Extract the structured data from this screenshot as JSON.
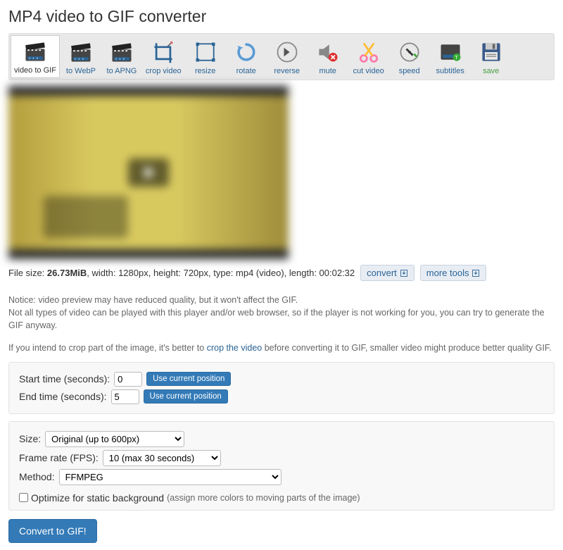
{
  "title": "MP4 video to GIF converter",
  "toolbar": [
    {
      "label": "video to GIF",
      "icon": "clapper"
    },
    {
      "label": "to WebP",
      "icon": "clapper"
    },
    {
      "label": "to APNG",
      "icon": "clapper"
    },
    {
      "label": "crop video",
      "icon": "crop"
    },
    {
      "label": "resize",
      "icon": "resize"
    },
    {
      "label": "rotate",
      "icon": "rotate"
    },
    {
      "label": "reverse",
      "icon": "reverse"
    },
    {
      "label": "mute",
      "icon": "mute"
    },
    {
      "label": "cut video",
      "icon": "cut"
    },
    {
      "label": "speed",
      "icon": "speed"
    },
    {
      "label": "subtitles",
      "icon": "subtitles"
    },
    {
      "label": "save",
      "icon": "save"
    }
  ],
  "file_info": {
    "prefix": "File size: ",
    "size": "26.73MiB",
    "rest": ", width: 1280px, height: 720px, type: mp4 (video), length: 00:02:32"
  },
  "convert_btn": "convert",
  "more_tools_btn": "more tools",
  "notice_line1": "Notice: video preview may have reduced quality, but it won't affect the GIF.",
  "notice_line2": "Not all types of video can be played with this player and/or web browser, so if the player is not working for you, you can try to generate the GIF anyway.",
  "notice_line3_a": "If you intend to crop part of the image, it's better to ",
  "notice_line3_link": "crop the video",
  "notice_line3_b": " before converting it to GIF, smaller video might produce better quality GIF.",
  "time_panel": {
    "start_label": "Start time (seconds):",
    "start_value": "0",
    "end_label": "End time (seconds):",
    "end_value": "5",
    "use_current": "Use current position"
  },
  "options_panel": {
    "size_label": "Size:",
    "size_value": "Original (up to 600px)",
    "fps_label": "Frame rate (FPS):",
    "fps_value": "10 (max 30 seconds)",
    "method_label": "Method:",
    "method_value": "FFMPEG",
    "optimize_label": "Optimize for static background",
    "optimize_hint": "(assign more colors to moving parts of the image)"
  },
  "convert_main": "Convert to GIF!"
}
